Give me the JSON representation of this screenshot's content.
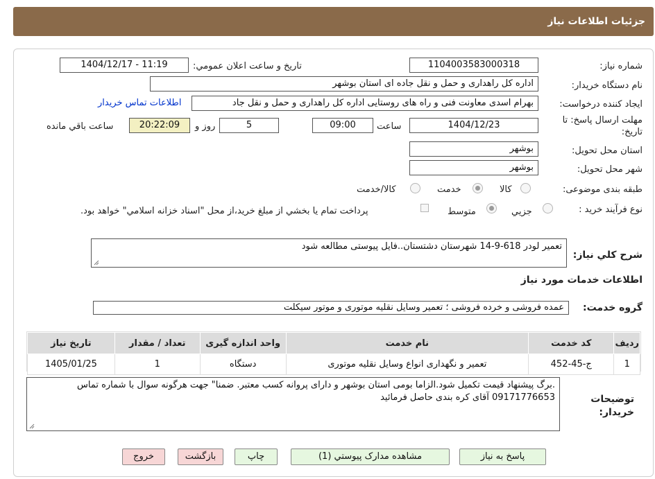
{
  "header": {
    "title": "جزئیات اطلاعات نیاز"
  },
  "form": {
    "need_number_label": "شماره نیاز:",
    "need_number": "1104003583000318",
    "announce_label": "تاریخ و ساعت اعلان عمومي:",
    "announce_value": "1404/12/17 - 11:19",
    "buyer_org_label": "نام دستگاه خريدار:",
    "buyer_org": "اداره کل راهداری و حمل و نقل جاده ای استان بوشهر",
    "requester_label": "ايجاد کننده درخواست:",
    "requester": "بهرام اسدی معاونت فنی و راه های روستایی اداره کل راهداری و حمل و نقل جاد",
    "contact_link": "اطلاعات تماس خريدار",
    "deadline_label": "مهلت ارسال پاسخ: تا تاريخ:",
    "deadline_date": "1404/12/23",
    "time_label": "ساعت",
    "deadline_time": "09:00",
    "days_value": "5",
    "days_label": "روز و",
    "remaining_time": "20:22:09",
    "remaining_label": "ساعت باقي مانده",
    "province_label": "استان محل تحويل:",
    "province": "بوشهر",
    "city_label": "شهر محل تحويل:",
    "city": "بوشهر",
    "category_label": "طبقه بندی موضوعی:",
    "category_options": [
      "کالا",
      "خدمت",
      "کالا/خدمت"
    ],
    "category_selected": "خدمت",
    "process_label": "نوع فرآيند خريد :",
    "process_options": [
      "جزيي",
      "متوسط"
    ],
    "process_selected": "متوسط",
    "payment_note": "پرداخت تمام يا بخشي از مبلغ خريد،از محل \"اسناد خزانه اسلامي\" خواهد بود.",
    "description_label": "شرح کلي نياز:",
    "description": "تعمیر لودر 618-9-14 شهرستان دشتستان..فایل پیوستی مطالعه شود",
    "services_heading": "اطلاعات خدمات مورد نياز",
    "service_group_label": "گروه خدمت:",
    "service_group": "عمده فروشی و خرده فروشی ؛ تعمیر وسایل نقلیه موتوری و موتور سیکلت"
  },
  "table": {
    "headers": [
      "رديف",
      "کد خدمت",
      "نام خدمت",
      "واحد اندازه گيری",
      "تعداد / مقدار",
      "تاريخ نياز"
    ],
    "rows": [
      [
        "1",
        "ج-45-452",
        "تعمیر و نگهداری انواع وسایل نقلیه موتوری",
        "دستگاه",
        "1",
        "1405/01/25"
      ]
    ]
  },
  "buyer_notes_label": "توضيحات خريدار:",
  "buyer_notes": ".برگ پیشنهاد قیمت تکمیل شود.الزاما بومی استان بوشهر و دارای پروانه کسب معتبر. ضمنا\" جهت هرگونه سوال با شماره تماس 09171776653 آقای کره بندی حاصل فرمائید",
  "buttons": {
    "reply": "پاسخ به نياز",
    "attachments": "مشاهده مدارک پيوستي (1)",
    "print": "چاپ",
    "back": "بازگشت",
    "exit": "خروج"
  },
  "colors": {
    "header_bg": "#8a6a4a",
    "link": "#0033cc",
    "remaining_bg": "#f3f0c2"
  }
}
